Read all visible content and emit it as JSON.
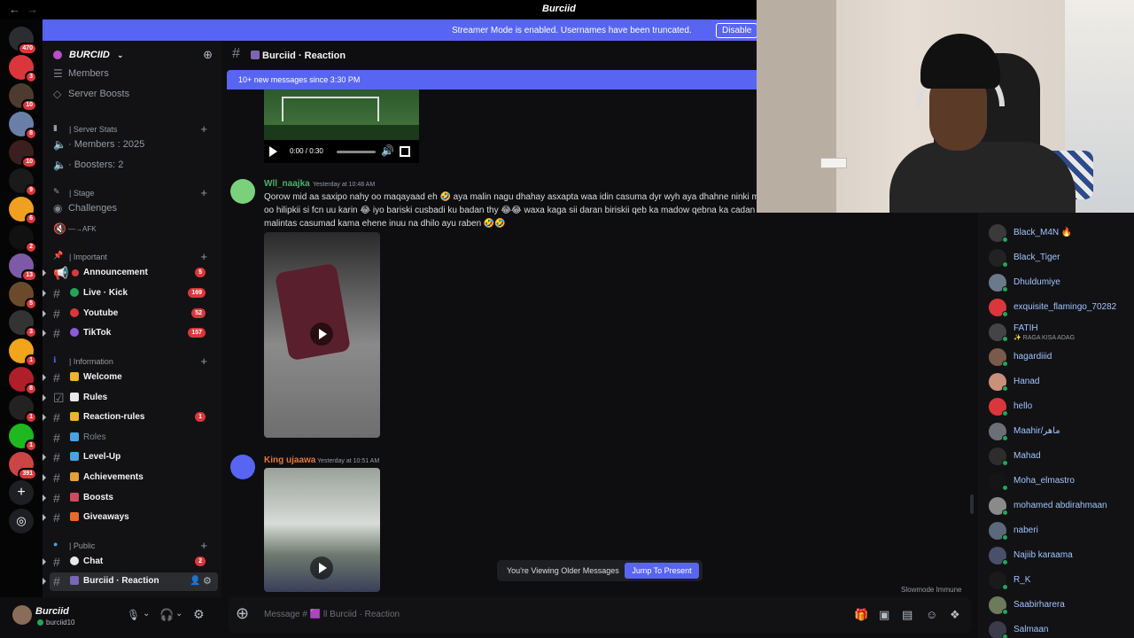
{
  "app": {
    "title": "Burciid"
  },
  "banner": {
    "text": "Streamer Mode is enabled. Usernames have been truncated.",
    "button": "Disable"
  },
  "rail": {
    "badges": [
      "470",
      "3",
      "10",
      "8",
      "10",
      "9",
      "6",
      "2",
      "13",
      "5",
      "3",
      "1",
      "8",
      "1",
      "1",
      "391"
    ]
  },
  "sidebar": {
    "guild_name": "BURCIID",
    "top_items": [
      {
        "label": "Members"
      },
      {
        "label": "Server Boosts"
      }
    ],
    "server_stats": {
      "category": "| Server Stats",
      "items": [
        "· Members : 2025",
        "· Boosters: 2"
      ]
    },
    "stage": {
      "category": "| Stage",
      "items": [
        "Challenges",
        "—→AFK"
      ]
    },
    "important": {
      "category": "| Important",
      "channels": [
        {
          "label": "Announcement",
          "badge": "5"
        },
        {
          "label": "Live · Kick",
          "badge": "169"
        },
        {
          "label": "Youtube",
          "badge": "52"
        },
        {
          "label": "TikTok",
          "badge": "157"
        }
      ]
    },
    "information": {
      "category": "| Information",
      "channels": [
        {
          "label": "Welcome",
          "badge": ""
        },
        {
          "label": "Rules",
          "badge": ""
        },
        {
          "label": "Reaction-rules",
          "badge": "1"
        },
        {
          "label": "Roles",
          "badge": ""
        },
        {
          "label": "Level-Up",
          "badge": ""
        },
        {
          "label": "Achievements",
          "badge": ""
        },
        {
          "label": "Boosts",
          "badge": ""
        },
        {
          "label": "Giveaways",
          "badge": ""
        }
      ]
    },
    "public": {
      "category": "| Public",
      "channels": [
        {
          "label": "Chat",
          "badge": "2"
        },
        {
          "label": "Burciid · Reaction",
          "badge": ""
        }
      ]
    },
    "bullet": "ll"
  },
  "user": {
    "name": "Burciid",
    "tag": "burciid10"
  },
  "channel": {
    "name": "Burciid · Reaction"
  },
  "new_messages": "10+ new messages since 3:30 PM",
  "video1": {
    "time": "0:00 / 0:30"
  },
  "messages": [
    {
      "author": "Wll_naajka",
      "time": "Yesterday at 10:48 AM",
      "line1": "Qorow mid aa saxipo nahy oo maqayaad eh 🤣 aya malin nagu dhahay asxapta waa idin casuma dyr wyh aya dhahne ninki m",
      "line2": "oo hilipkii si fcn uu karin 😂 iyo bariski cusbadi ku badan thy 😂😂 waxa kaga sii daran biriskii qeb ka madow qebna ka cadan",
      "line3": "malintas casumad kama ehene inuu na dhilo ayu raben 🤣🤣"
    },
    {
      "author": "King ujaawa",
      "time": "Yesterday at 10:51 AM"
    }
  ],
  "older_bar": {
    "text": "You're Viewing Older Messages",
    "button": "Jump To Present"
  },
  "slowmode": "Slowmode Immune",
  "composer": {
    "placeholder": "Message # 🟪 ll Burciid · Reaction"
  },
  "members": [
    {
      "name": "Black_M4N 🔥",
      "sub": ""
    },
    {
      "name": "Black_Tiger",
      "sub": ""
    },
    {
      "name": "Dhuldumiye",
      "sub": ""
    },
    {
      "name": "exquisite_flamingo_70282",
      "sub": ""
    },
    {
      "name": "FATIH",
      "sub": "✨ RAGA KISA ADAG"
    },
    {
      "name": "hagardiiid",
      "sub": ""
    },
    {
      "name": "Hanad",
      "sub": ""
    },
    {
      "name": "hello",
      "sub": ""
    },
    {
      "name": "Maahir/ماهر",
      "sub": ""
    },
    {
      "name": "Mahad",
      "sub": ""
    },
    {
      "name": "Moha_elmastro",
      "sub": ""
    },
    {
      "name": "mohamed abdirahmaan",
      "sub": ""
    },
    {
      "name": "naberi",
      "sub": ""
    },
    {
      "name": "Najiib karaama",
      "sub": ""
    },
    {
      "name": "R_K",
      "sub": ""
    },
    {
      "name": "Saabirharera",
      "sub": ""
    },
    {
      "name": "Salmaan",
      "sub": ""
    }
  ],
  "colors": {
    "accent": "#5865f2",
    "badge": "#da373c",
    "online": "#23a55a",
    "author1": "#4fb06b",
    "author2": "#e0793a"
  }
}
